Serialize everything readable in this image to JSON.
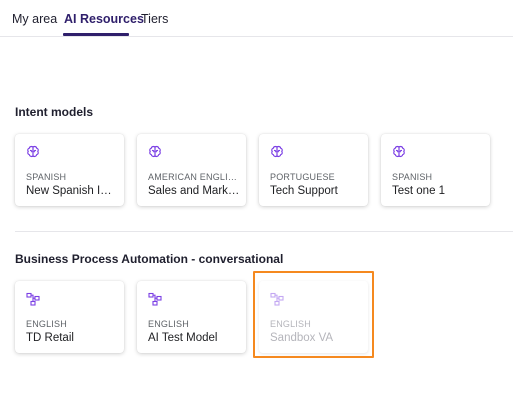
{
  "tabs": [
    {
      "label": "My area"
    },
    {
      "label": "AI Resources"
    },
    {
      "label": "Tiers"
    }
  ],
  "sections": {
    "intent": {
      "title": "Intent models",
      "cards": [
        {
          "language": "SPANISH",
          "name": "New Spanish Intent Model",
          "icon": "brain-icon"
        },
        {
          "language": "AMERICAN ENGLISH",
          "name": "Sales and Marketing",
          "icon": "brain-icon"
        },
        {
          "language": "PORTUGUESE",
          "name": "Tech Support",
          "icon": "brain-icon"
        },
        {
          "language": "SPANISH",
          "name": "Test one 1",
          "icon": "brain-icon"
        }
      ]
    },
    "bpa": {
      "title": "Business Process Automation - conversational",
      "cards": [
        {
          "language": "ENGLISH",
          "name": "TD Retail",
          "icon": "flow-diagram-icon"
        },
        {
          "language": "ENGLISH",
          "name": "AI Test Model",
          "icon": "flow-diagram-icon"
        },
        {
          "language": "ENGLISH",
          "name": "Sandbox VA",
          "icon": "flow-diagram-icon",
          "state": "disabled"
        }
      ]
    }
  },
  "colors": {
    "accent": "#2f1f6b",
    "icon": "#7b3fe4",
    "highlight": "#f5891f"
  }
}
